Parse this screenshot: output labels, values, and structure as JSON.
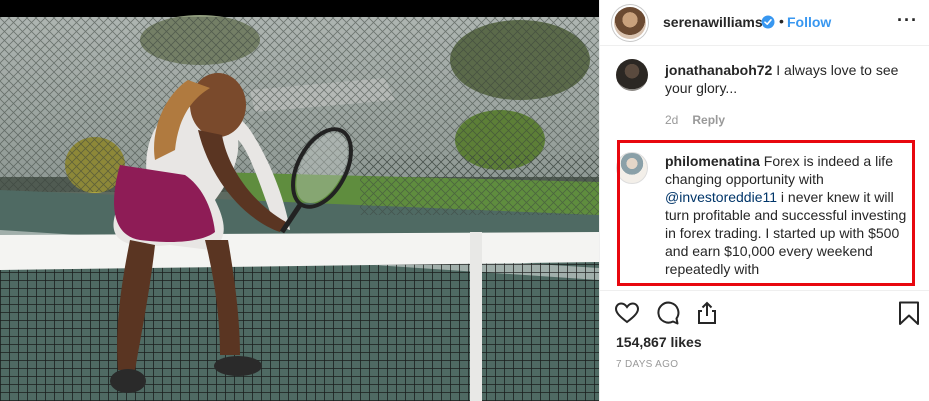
{
  "post": {
    "username": "serenawilliams",
    "separator": "•",
    "follow_label": "Follow",
    "more_label": "···",
    "likes": "154,867 likes",
    "time_ago": "7 DAYS AGO"
  },
  "comments": [
    {
      "username": "jonathanaboh72",
      "text": " I always love to see your glory...",
      "age": "2d",
      "reply_label": "Reply"
    },
    {
      "username": "philomenatina",
      "text_before": " Forex is indeed a life changing opportunity with ",
      "mention": "@investoreddie11",
      "text_after": " i never knew it will turn profitable and successful investing in forex trading. I started up with $500 and earn $10,000 every weekend repeatedly with",
      "highlighted": true,
      "highlight_color": "#e8070f"
    }
  ],
  "colors": {
    "link": "#3897f0",
    "verified": "#3897f0",
    "meta": "#999999",
    "text": "#262626"
  },
  "icons": [
    "verified-badge-icon",
    "more-options-icon",
    "heart-icon",
    "comment-icon",
    "share-icon",
    "bookmark-icon"
  ]
}
